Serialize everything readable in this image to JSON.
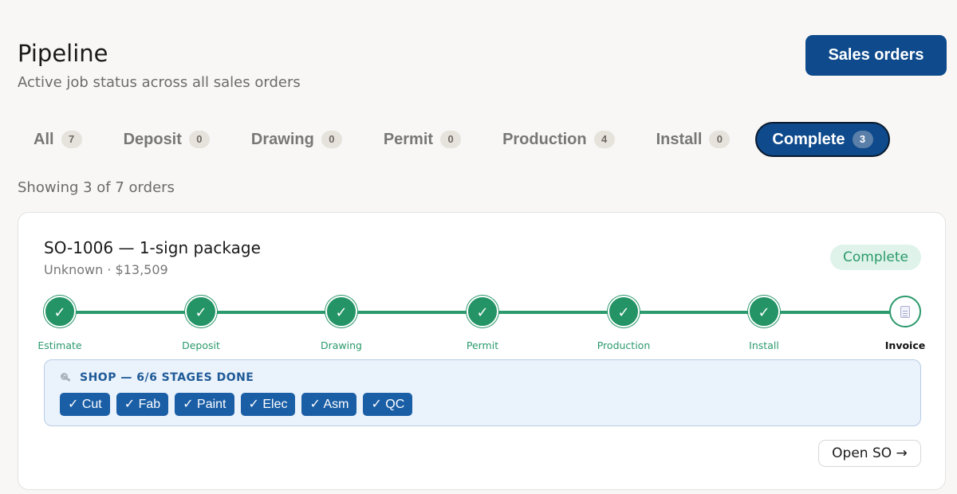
{
  "header": {
    "title": "Pipeline",
    "subtitle": "Active job status across all sales orders",
    "sales_orders_label": "Sales orders"
  },
  "tabs": [
    {
      "label": "All",
      "count": "7",
      "active": false
    },
    {
      "label": "Deposit",
      "count": "0",
      "active": false
    },
    {
      "label": "Drawing",
      "count": "0",
      "active": false
    },
    {
      "label": "Permit",
      "count": "0",
      "active": false
    },
    {
      "label": "Production",
      "count": "4",
      "active": false
    },
    {
      "label": "Install",
      "count": "0",
      "active": false
    },
    {
      "label": "Complete",
      "count": "3",
      "active": true
    }
  ],
  "showing_text": "Showing 3 of 7 orders",
  "order": {
    "title": "SO-1006 — 1-sign package",
    "subtitle": "Unknown · $13,509",
    "status": "Complete",
    "steps": [
      {
        "label": "Estimate",
        "glyph": "✓",
        "done": true
      },
      {
        "label": "Deposit",
        "glyph": "✓",
        "done": true
      },
      {
        "label": "Drawing",
        "glyph": "✓",
        "done": true
      },
      {
        "label": "Permit",
        "glyph": "✓",
        "done": true
      },
      {
        "label": "Production",
        "glyph": "✓",
        "done": true
      },
      {
        "label": "Install",
        "glyph": "✓",
        "done": true
      },
      {
        "label": "Invoice",
        "icon": "document-icon",
        "done": false
      }
    ],
    "shop": {
      "header": "SHOP — 6/6 STAGES DONE",
      "icon": "wrench-icon",
      "chips": [
        "✓ Cut",
        "✓ Fab",
        "✓ Paint",
        "✓ Elec",
        "✓ Asm",
        "✓ QC"
      ]
    },
    "open_label": "Open SO →"
  },
  "colors": {
    "primary": "#0e4a8c",
    "success": "#249466",
    "shop_chip": "#1a5ea6",
    "badge_bg": "#dff3ea"
  }
}
